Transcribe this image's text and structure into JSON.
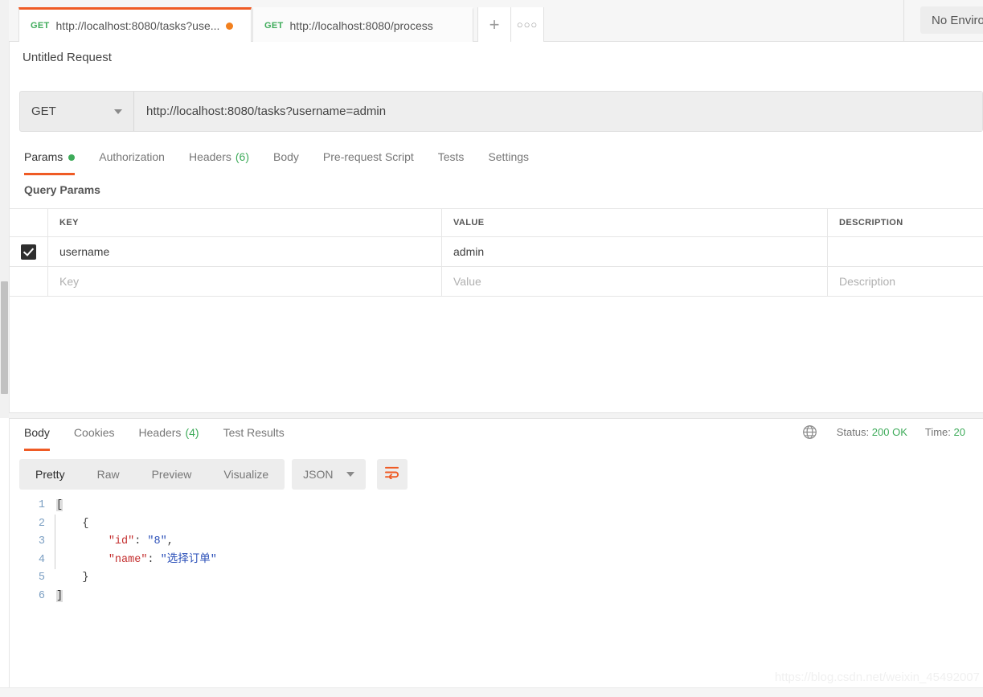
{
  "colors": {
    "accent": "#ef5b25",
    "success": "#3eab5a",
    "unsaved_dot": "#f2801e",
    "json_key": "#c42f2f",
    "json_string": "#2a4fb8"
  },
  "tabbar": {
    "tabs": [
      {
        "method": "GET",
        "label": "http://localhost:8080/tasks?use...",
        "unsaved": true,
        "active": true
      },
      {
        "method": "GET",
        "label": "http://localhost:8080/process",
        "unsaved": false,
        "active": false
      }
    ],
    "new_tab_label": "+",
    "more_label": "000",
    "environment_label": "No Enviro"
  },
  "request": {
    "title": "Untitled Request",
    "method": "GET",
    "url": "http://localhost:8080/tasks?username=admin",
    "tabs": [
      {
        "label": "Params",
        "dot": true,
        "count": "",
        "active": true
      },
      {
        "label": "Authorization",
        "dot": false,
        "count": "",
        "active": false
      },
      {
        "label": "Headers",
        "dot": false,
        "count": "(6)",
        "active": false
      },
      {
        "label": "Body",
        "dot": false,
        "count": "",
        "active": false
      },
      {
        "label": "Pre-request Script",
        "dot": false,
        "count": "",
        "active": false
      },
      {
        "label": "Tests",
        "dot": false,
        "count": "",
        "active": false
      },
      {
        "label": "Settings",
        "dot": false,
        "count": "",
        "active": false
      }
    ],
    "query_params_label": "Query Params",
    "table": {
      "headers": {
        "key": "KEY",
        "value": "VALUE",
        "description": "DESCRIPTION"
      },
      "rows": [
        {
          "checked": true,
          "key": "username",
          "value": "admin",
          "description": ""
        }
      ],
      "placeholders": {
        "key": "Key",
        "value": "Value",
        "description": "Description"
      }
    }
  },
  "response": {
    "tabs": [
      {
        "label": "Body",
        "count": "",
        "active": true
      },
      {
        "label": "Cookies",
        "count": "",
        "active": false
      },
      {
        "label": "Headers",
        "count": "(4)",
        "active": false
      },
      {
        "label": "Test Results",
        "count": "",
        "active": false
      }
    ],
    "status_label": "Status:",
    "status_value": "200 OK",
    "time_label": "Time:",
    "time_value": "20",
    "view_modes": [
      {
        "label": "Pretty",
        "active": true
      },
      {
        "label": "Raw",
        "active": false
      },
      {
        "label": "Preview",
        "active": false
      },
      {
        "label": "Visualize",
        "active": false
      }
    ],
    "format": "JSON",
    "body_lines": [
      {
        "n": "1",
        "segments": [
          {
            "t": "[",
            "c": "brk"
          }
        ]
      },
      {
        "n": "2",
        "segments": [
          {
            "t": "    {",
            "c": "punc"
          }
        ]
      },
      {
        "n": "3",
        "segments": [
          {
            "t": "        ",
            "c": "punc"
          },
          {
            "t": "\"id\"",
            "c": "key"
          },
          {
            "t": ": ",
            "c": "punc"
          },
          {
            "t": "\"8\"",
            "c": "str"
          },
          {
            "t": ",",
            "c": "punc"
          }
        ]
      },
      {
        "n": "4",
        "segments": [
          {
            "t": "        ",
            "c": "punc"
          },
          {
            "t": "\"name\"",
            "c": "key"
          },
          {
            "t": ": ",
            "c": "punc"
          },
          {
            "t": "\"选择订单\"",
            "c": "str"
          }
        ]
      },
      {
        "n": "5",
        "segments": [
          {
            "t": "    }",
            "c": "punc"
          }
        ]
      },
      {
        "n": "6",
        "segments": [
          {
            "t": "]",
            "c": "brk"
          }
        ]
      }
    ]
  },
  "watermark": "https://blog.csdn.net/weixin_45492007"
}
